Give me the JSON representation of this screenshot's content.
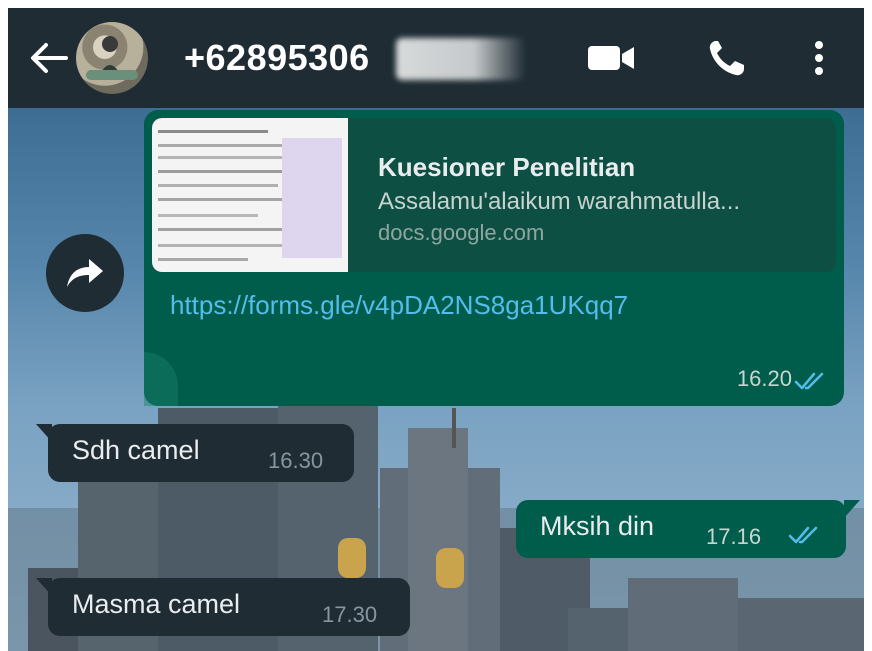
{
  "header": {
    "contact_name": "+62895306",
    "back_icon": "arrow-left-icon",
    "video_icon": "video-camera-icon",
    "call_icon": "phone-icon",
    "menu_icon": "more-vertical-icon"
  },
  "messages": [
    {
      "direction": "outgoing",
      "forwarded": true,
      "preview": {
        "title": "Kuesioner Penelitian",
        "description": "Assalamu'alaikum warahmatulla...",
        "domain": "docs.google.com"
      },
      "link": "https://forms.gle/v4pDA2NS8ga1UKqq7",
      "time": "16.20",
      "status": "read"
    },
    {
      "direction": "incoming",
      "text": "Sdh camel",
      "time": "16.30"
    },
    {
      "direction": "outgoing",
      "text": "Mksih din",
      "time": "17.16",
      "status": "read"
    },
    {
      "direction": "incoming",
      "text": "Masma camel",
      "time": "17.30"
    }
  ],
  "colors": {
    "header_bg": "#1f2c34",
    "outgoing_bubble": "#005c4b",
    "incoming_bubble": "#1f2c34",
    "link": "#53bdeb",
    "read_ticks": "#53bdeb"
  }
}
